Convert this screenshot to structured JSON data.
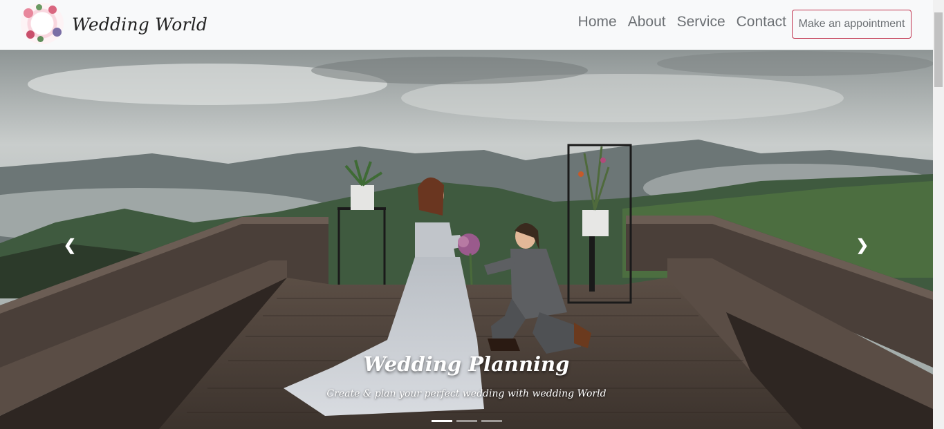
{
  "brand": {
    "name": "Wedding World",
    "logo_icon": "floral-wreath-logo"
  },
  "nav": {
    "links": [
      "Home",
      "About",
      "Service",
      "Contact"
    ],
    "cta_label": "Make an appointment",
    "cta_border_color": "#c0304b"
  },
  "carousel": {
    "title": "Wedding Planning",
    "subtitle": "Create & plan your perfect wedding with wedding World",
    "prev_icon": "chevron-left-icon",
    "next_icon": "chevron-right-icon",
    "prev_glyph": "❮",
    "next_glyph": "❯",
    "slide_count": 3,
    "active_slide": 1
  }
}
